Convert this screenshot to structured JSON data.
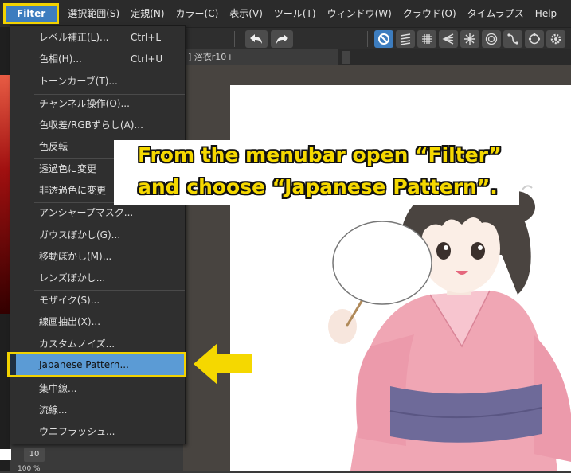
{
  "menubar": {
    "items": [
      {
        "label": "Filter",
        "active": true
      },
      {
        "label": "選択範囲(S)"
      },
      {
        "label": "定規(N)"
      },
      {
        "label": "カラー(C)"
      },
      {
        "label": "表示(V)"
      },
      {
        "label": "ツール(T)"
      },
      {
        "label": "ウィンドウ(W)"
      },
      {
        "label": "クラウド(O)"
      },
      {
        "label": "タイムラプス"
      },
      {
        "label": "Help"
      }
    ]
  },
  "toolbar": {
    "undo_icon": "undo-arrow",
    "redo_icon": "redo-arrow",
    "ruler_icons": [
      "forbidden-circle",
      "parallel-lines",
      "grid",
      "converging-lines",
      "radial-lines",
      "concentric-circles",
      "curve",
      "circle-nodes",
      "gear"
    ]
  },
  "canvas_tab": {
    "label": "] 浴衣r10+"
  },
  "filter_menu": {
    "items": [
      {
        "label": "レベル補正(L)...",
        "shortcut": "Ctrl+L"
      },
      {
        "label": "色相(H)...",
        "shortcut": "Ctrl+U"
      },
      {
        "label": "トーンカーブ(T)..."
      },
      {
        "label": "チャンネル操作(O)..."
      },
      {
        "label": "色収差/RGBずらし(A)..."
      },
      {
        "label": "色反転"
      },
      {
        "label": "透過色に変更"
      },
      {
        "label": "非透過色に変更"
      },
      {
        "label": "アンシャープマスク..."
      },
      {
        "label": "ガウスぼかし(G)..."
      },
      {
        "label": "移動ぼかし(M)..."
      },
      {
        "label": "レンズぼかし..."
      },
      {
        "label": "モザイク(S)..."
      },
      {
        "label": "線画抽出(X)..."
      },
      {
        "label": "カスタムノイズ..."
      },
      {
        "label": "Japanese Pattern...",
        "selected": true
      },
      {
        "label": "集中線..."
      },
      {
        "label": "流線..."
      },
      {
        "label": "ウニフラッシュ..."
      }
    ]
  },
  "callout": {
    "line1": "From the menubar open “Filter”",
    "line2": "and choose “Japanese Pattern”."
  },
  "left_panel": {
    "brush_size": "10",
    "zoom_partial": "100 %"
  },
  "colors": {
    "highlight_yellow": "#f2d200",
    "menu_selected_blue": "#5b9bd5",
    "menubar_active_blue": "#3d7dbf",
    "kimono_pink": "#f0a6b4",
    "obi_purple": "#6e6a99",
    "hair": "#4a4440"
  }
}
